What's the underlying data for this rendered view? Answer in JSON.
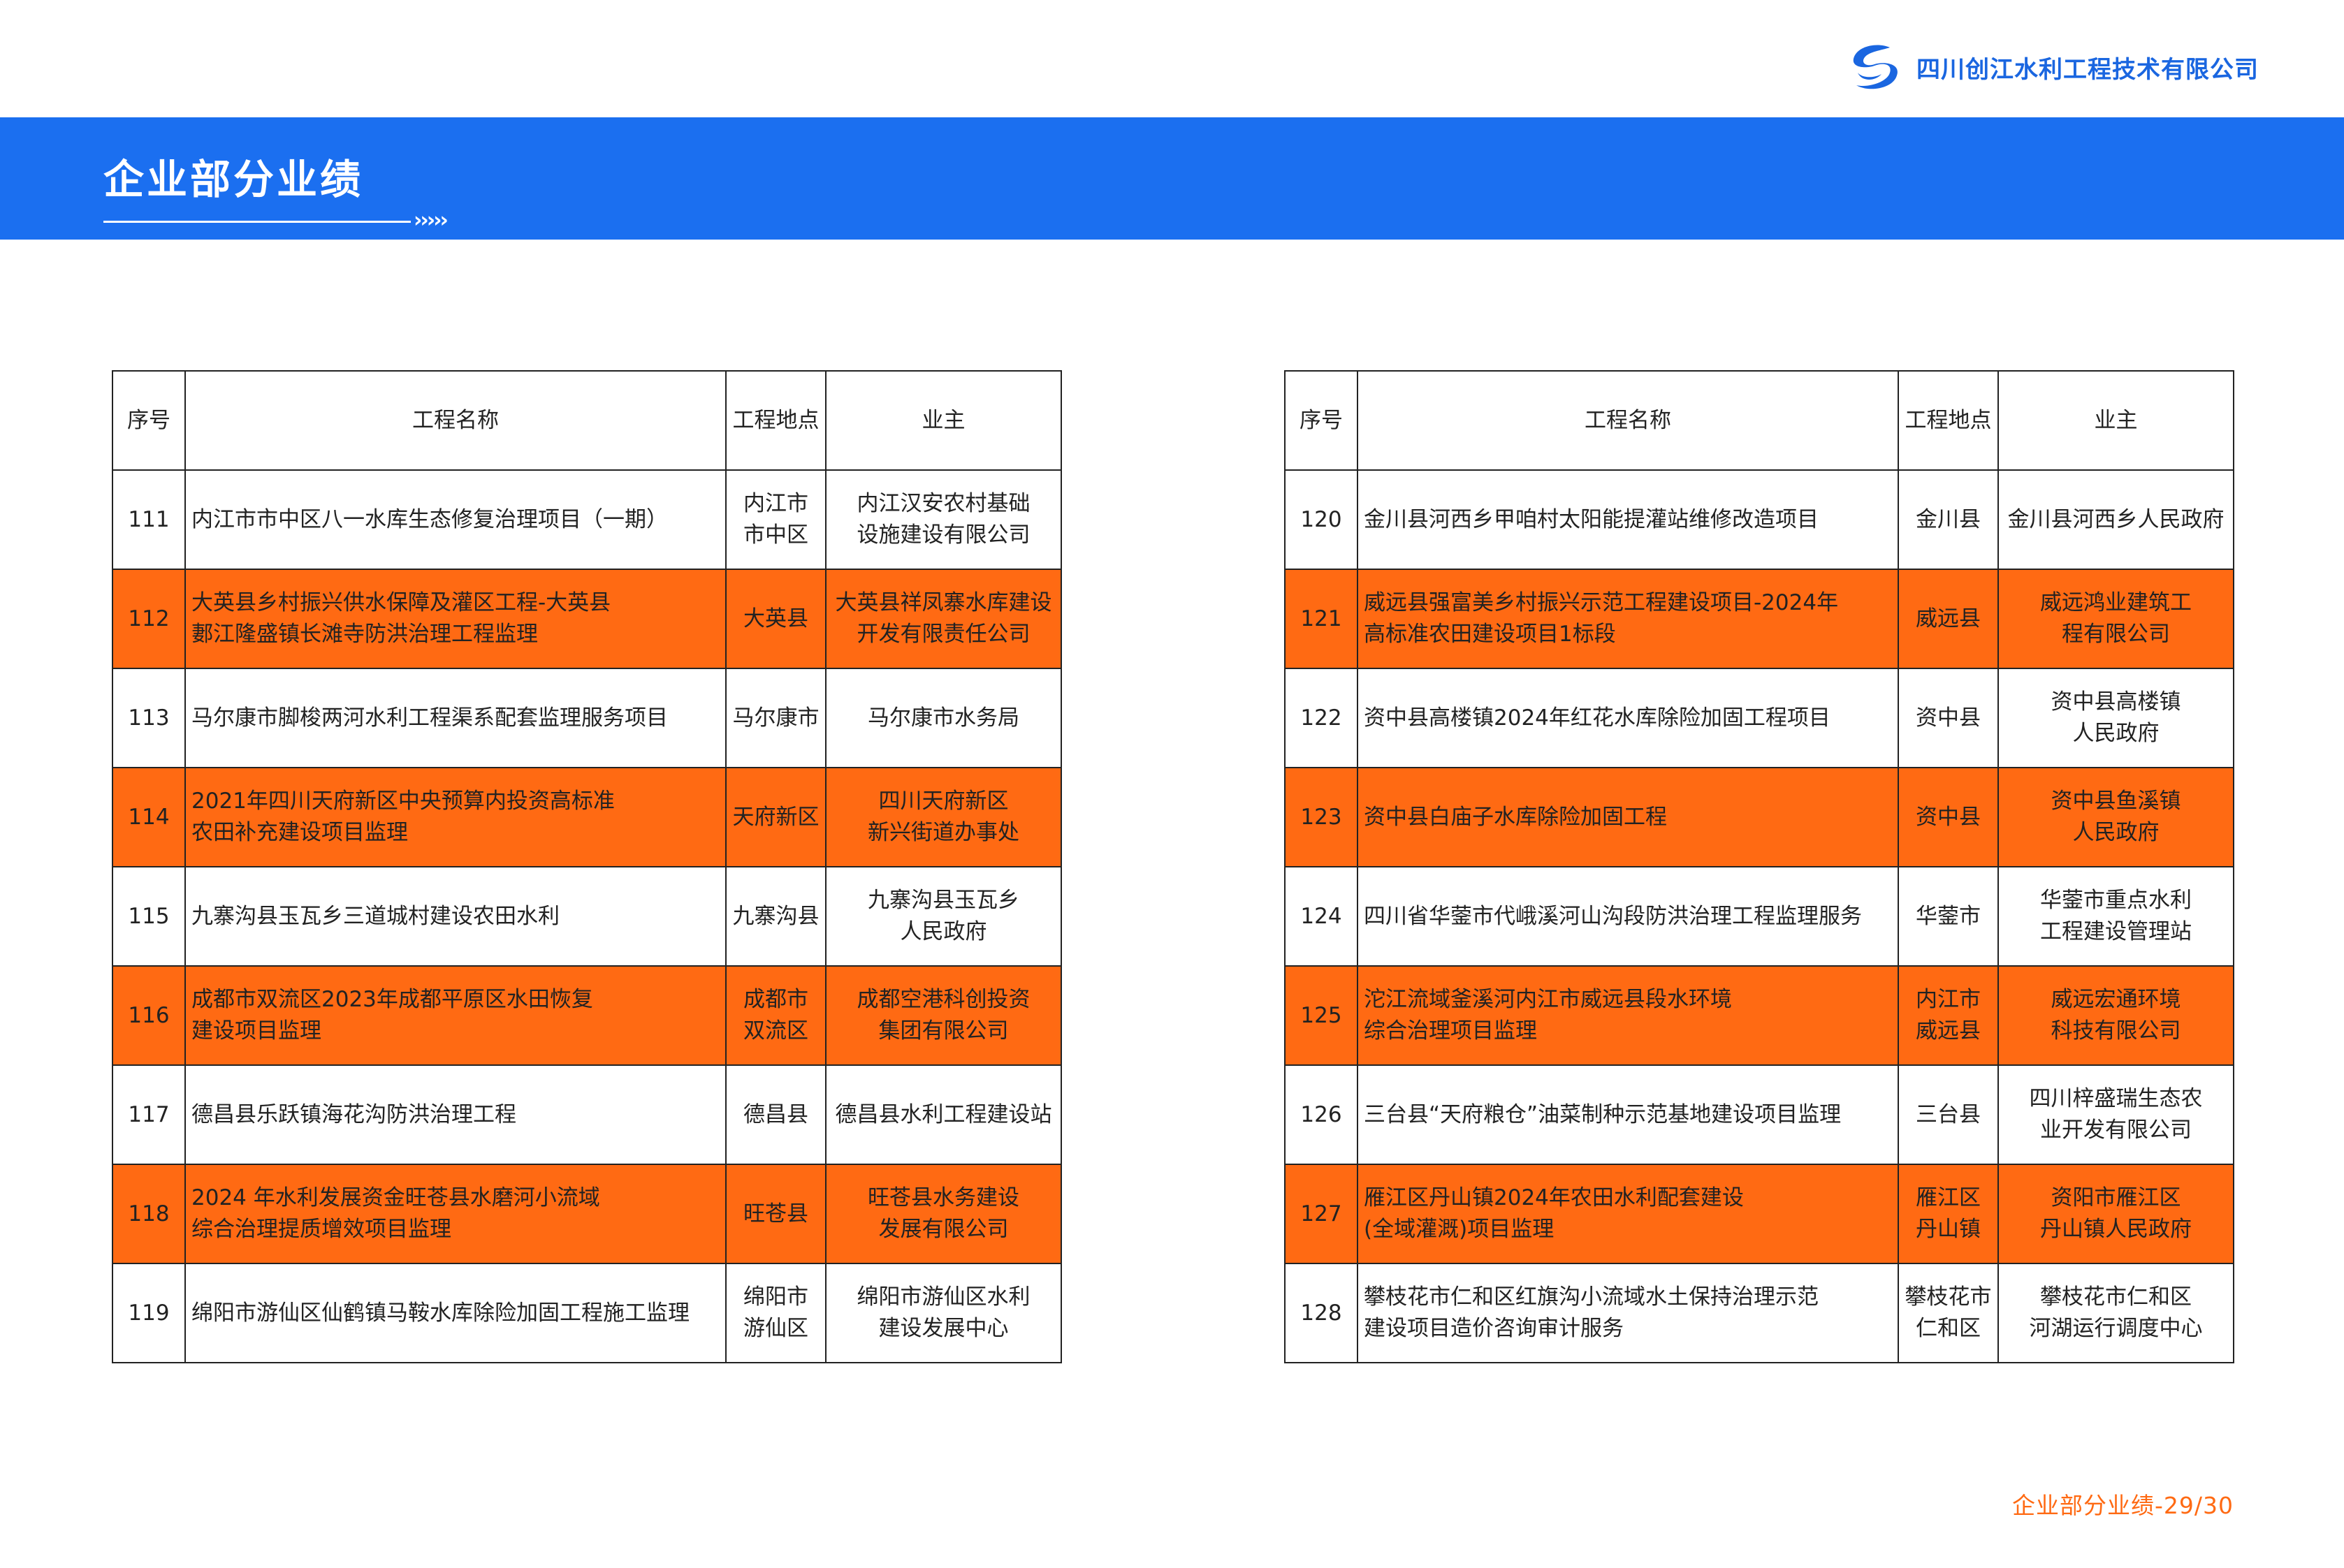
{
  "header": {
    "company_name": "四川创江水利工程技术有限公司",
    "logo_icon": "company-logo-icon",
    "brand_color": "#1b6ff0",
    "accent_color": "#ff6a13"
  },
  "banner": {
    "title": "企业部分业绩",
    "arrows": "›››››"
  },
  "table_columns": [
    "序号",
    "工程名称",
    "工程地点",
    "业主"
  ],
  "left_rows": [
    {
      "num": "111",
      "name": "内江市市中区八一水库生态修复治理项目（一期）",
      "location": "内江市\n市中区",
      "owner": "内江汉安农村基础\n设施建设有限公司",
      "highlight": false
    },
    {
      "num": "112",
      "name": "大英县乡村振兴供水保障及灌区工程-大英县\n郪江隆盛镇长滩寺防洪治理工程监理",
      "location": "大英县",
      "owner": "大英县祥凤寨水库建设\n开发有限责任公司",
      "highlight": true
    },
    {
      "num": "113",
      "name": "马尔康市脚梭两河水利工程渠系配套监理服务项目",
      "location": "马尔康市",
      "owner": "马尔康市水务局",
      "highlight": false
    },
    {
      "num": "114",
      "name": "2021年四川天府新区中央预算内投资高标准\n农田补充建设项目监理",
      "location": "天府新区",
      "owner": "四川天府新区\n新兴街道办事处",
      "highlight": true
    },
    {
      "num": "115",
      "name": "九寨沟县玉瓦乡三道城村建设农田水利",
      "location": "九寨沟县",
      "owner": "九寨沟县玉瓦乡\n人民政府",
      "highlight": false
    },
    {
      "num": "116",
      "name": "成都市双流区2023年成都平原区水田恢复\n建设项目监理",
      "location": "成都市\n双流区",
      "owner": "成都空港科创投资\n集团有限公司",
      "highlight": true
    },
    {
      "num": "117",
      "name": "德昌县乐跃镇海花沟防洪治理工程",
      "location": "德昌县",
      "owner": "德昌县水利工程建设站",
      "highlight": false
    },
    {
      "num": "118",
      "name": "2024 年水利发展资金旺苍县水磨河小流域\n综合治理提质增效项目监理",
      "location": "旺苍县",
      "owner": "旺苍县水务建设\n发展有限公司",
      "highlight": true
    },
    {
      "num": "119",
      "name": "绵阳市游仙区仙鹤镇马鞍水库除险加固工程施工监理",
      "location": "绵阳市\n游仙区",
      "owner": "绵阳市游仙区水利\n建设发展中心",
      "highlight": false
    }
  ],
  "right_rows": [
    {
      "num": "120",
      "name": "金川县河西乡甲咱村太阳能提灌站维修改造项目",
      "location": "金川县",
      "owner": "金川县河西乡人民政府",
      "highlight": false
    },
    {
      "num": "121",
      "name": "威远县强富美乡村振兴示范工程建设项目-2024年\n高标准农田建设项目1标段",
      "location": "威远县",
      "owner": "威远鸿业建筑工\n程有限公司",
      "highlight": true
    },
    {
      "num": "122",
      "name": "资中县高楼镇2024年红花水库除险加固工程项目",
      "location": "资中县",
      "owner": "资中县高楼镇\n人民政府",
      "highlight": false
    },
    {
      "num": "123",
      "name": "资中县白庙子水库除险加固工程",
      "location": "资中县",
      "owner": "资中县鱼溪镇\n人民政府",
      "highlight": true
    },
    {
      "num": "124",
      "name": "四川省华蓥市代峨溪河山沟段防洪治理工程监理服务",
      "location": "华蓥市",
      "owner": "华蓥市重点水利\n工程建设管理站",
      "highlight": false
    },
    {
      "num": "125",
      "name": "沱江流域釜溪河内江市威远县段水环境\n综合治理项目监理",
      "location": "内江市\n威远县",
      "owner": "威远宏通环境\n科技有限公司",
      "highlight": true
    },
    {
      "num": "126",
      "name": "三台县“天府粮仓”油菜制种示范基地建设项目监理",
      "location": "三台县",
      "owner": "四川梓盛瑞生态农\n业开发有限公司",
      "highlight": false
    },
    {
      "num": "127",
      "name": "雁江区丹山镇2024年农田水利配套建设\n(全域灌溉)项目监理",
      "location": "雁江区\n丹山镇",
      "owner": "资阳市雁江区\n丹山镇人民政府",
      "highlight": true
    },
    {
      "num": "128",
      "name": "攀枝花市仁和区红旗沟小流域水土保持治理示范\n建设项目造价咨询审计服务",
      "location": "攀枝花市\n仁和区",
      "owner": "攀枝花市仁和区\n河湖运行调度中心",
      "highlight": false
    }
  ],
  "footer": {
    "text": "企业部分业绩-29/30"
  }
}
